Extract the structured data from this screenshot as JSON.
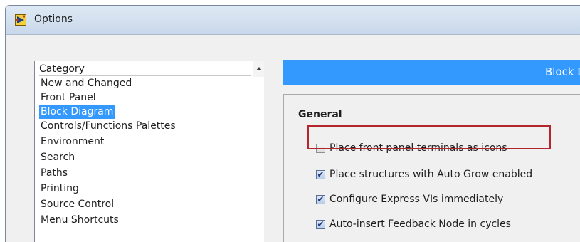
{
  "window": {
    "title": "Options",
    "app_icon": "labview-icon"
  },
  "category_list": {
    "header": "Category",
    "items": [
      "New and Changed",
      "Front Panel",
      "Block Diagram",
      "Controls/Functions Palettes",
      "Environment",
      "Search",
      "Paths",
      "Printing",
      "Source Control",
      "Menu Shortcuts"
    ],
    "selected": "Block Diagram"
  },
  "page_banner": {
    "title": "Block D"
  },
  "general": {
    "title": "General",
    "options": [
      {
        "label": "Place front panel terminals as icons",
        "checked": false,
        "highlighted": true
      },
      {
        "label": "Place structures with Auto Grow enabled",
        "checked": true
      },
      {
        "label": "Configure Express VIs immediately",
        "checked": true
      },
      {
        "label": "Auto-insert Feedback Node in cycles",
        "checked": true
      }
    ]
  },
  "colors": {
    "accent": "#3399ff",
    "highlight_border": "#b5252c"
  }
}
